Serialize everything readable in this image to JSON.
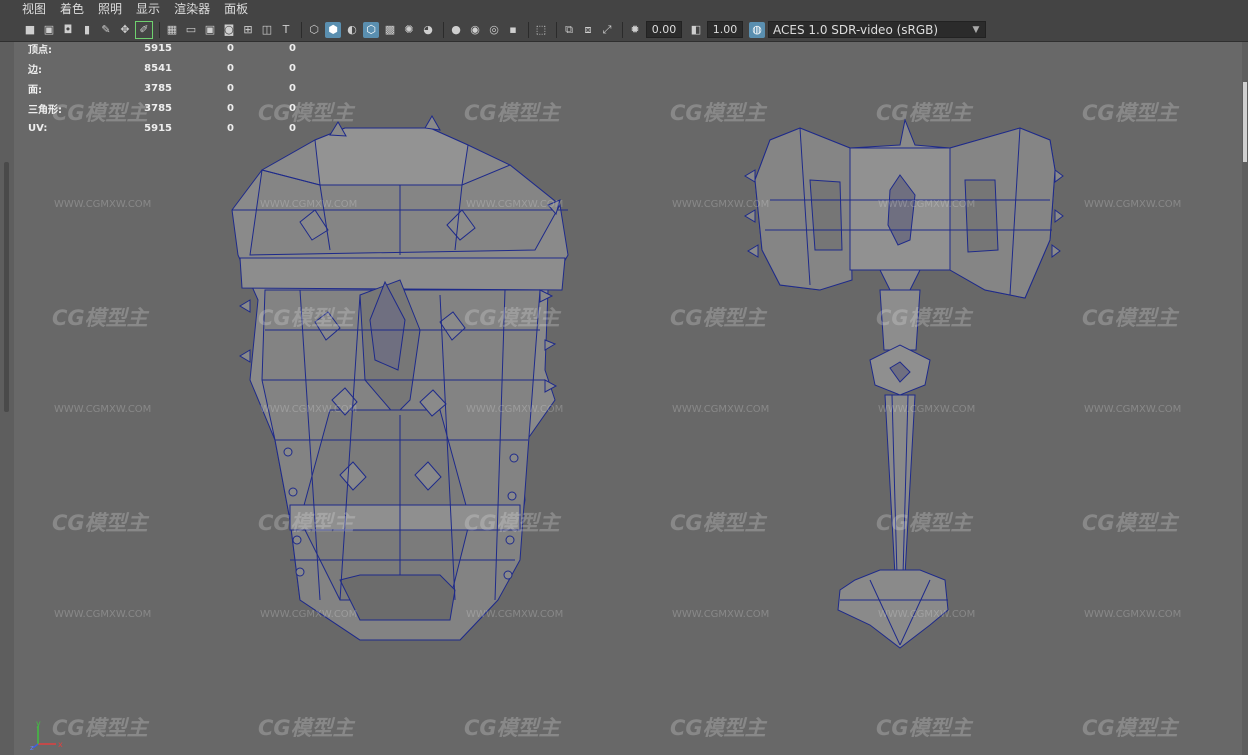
{
  "menu": [
    "视图",
    "着色",
    "照明",
    "显示",
    "渲染器",
    "面板"
  ],
  "toolbar": {
    "icons": [
      "camera-icon",
      "camera-lock-icon",
      "film-gate-icon",
      "bookmark-icon",
      "pencil-icon",
      "select-camera-icon",
      "grease-pencil-icon",
      "grid-icon",
      "resolution-gate-icon",
      "safe-action-icon",
      "field-chart-icon",
      "field-chart2-icon",
      "isolate-select-icon",
      "wireframe-icon",
      "smooth-shade-icon",
      "default-material-icon",
      "wireframe-on-shaded-icon",
      "xray-icon",
      "lights-icon",
      "shadows-icon",
      "ambient-occlusion-icon",
      "motion-blur-icon",
      "antialias-icon",
      "depth-of-field-icon",
      "select-highlight-icon",
      "panel-layout-icon",
      "panel-layout2-icon",
      "frame-all-icon",
      "exposure-icon",
      "gamma-icon",
      "color-mgmt-icon"
    ],
    "exposure_value": "0.00",
    "gamma_value": "1.00",
    "color_space": "ACES 1.0 SDR-video (sRGB)"
  },
  "hud": [
    {
      "label": "顶点:",
      "v1": "5915",
      "v2": "0",
      "v3": "0"
    },
    {
      "label": "边:",
      "v1": "8541",
      "v2": "0",
      "v3": "0"
    },
    {
      "label": "面:",
      "v1": "3785",
      "v2": "0",
      "v3": "0"
    },
    {
      "label": "三角形:",
      "v1": "3785",
      "v2": "0",
      "v3": "0"
    },
    {
      "label": "UV:",
      "v1": "5915",
      "v2": "0",
      "v3": "0"
    }
  ],
  "watermark": {
    "logo": "CG模型主",
    "url": "WWW.CGMXW.COM"
  },
  "axis": {
    "x": "x",
    "y": "y",
    "z": "z"
  },
  "colors": {
    "viewport_bg": "#686868",
    "mesh_fill": "#8a8a8a",
    "wire": "#1e2a8a",
    "ui_bg": "#444444"
  }
}
